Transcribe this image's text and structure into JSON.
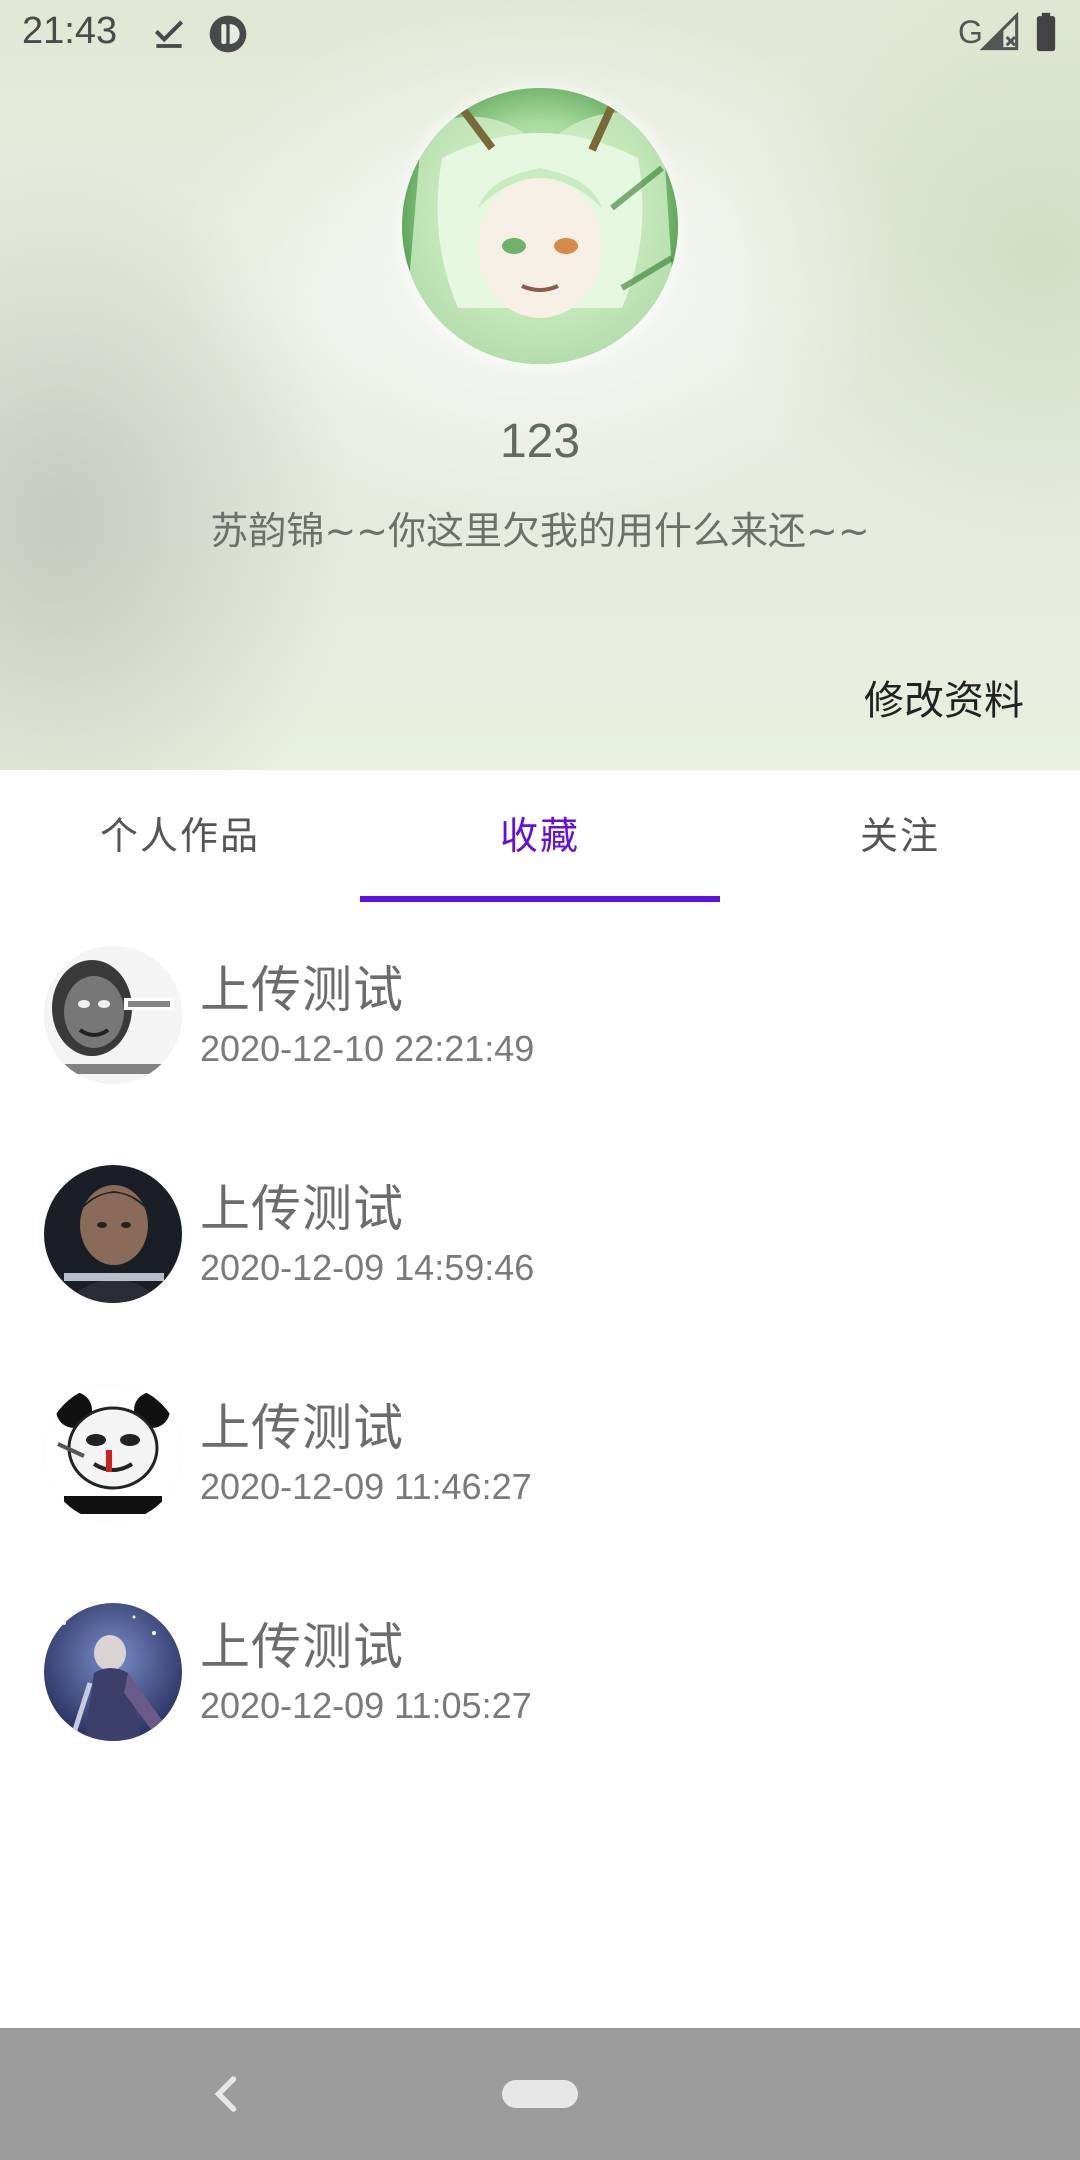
{
  "status_bar": {
    "time": "21:43",
    "network_label": "G",
    "icons": [
      "download-done-icon",
      "app-notification-icon",
      "signal-icon",
      "battery-icon"
    ]
  },
  "profile": {
    "username": "123",
    "signature": "苏韵锦~~你这里欠我的用什么来还~~",
    "edit_label": "修改资料",
    "avatar_icon": "anime-avatar-image"
  },
  "tabs": [
    {
      "label": "个人作品",
      "active": false
    },
    {
      "label": "收藏",
      "active": true
    },
    {
      "label": "关注",
      "active": false
    }
  ],
  "list": [
    {
      "title": "上传测试",
      "time": "2020-12-10 22:21:49",
      "thumb": "meme-face-thumbnail"
    },
    {
      "title": "上传测试",
      "time": "2020-12-09 14:59:46",
      "thumb": "man-portrait-thumbnail"
    },
    {
      "title": "上传测试",
      "time": "2020-12-09 11:46:27",
      "thumb": "panda-meme-thumbnail"
    },
    {
      "title": "上传测试",
      "time": "2020-12-09 11:05:27",
      "thumb": "knight-art-thumbnail"
    }
  ],
  "colors": {
    "accent": "#6210e0",
    "nav_bar": "#9b9b9b"
  }
}
